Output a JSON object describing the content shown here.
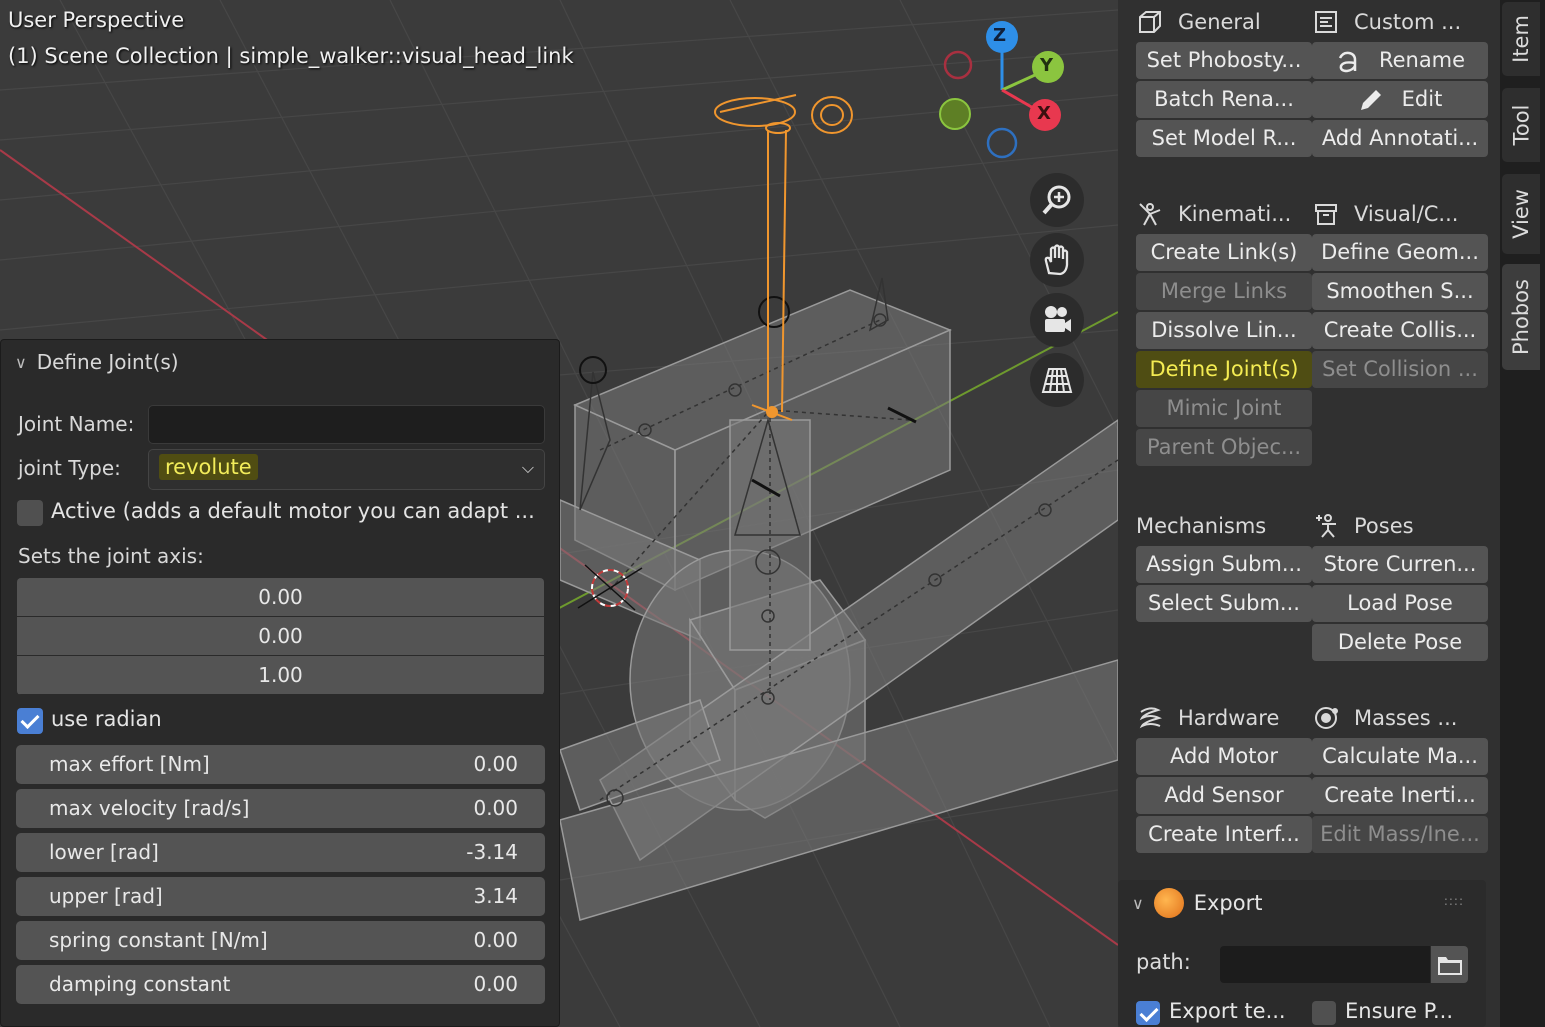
{
  "viewport": {
    "title": "User Perspective",
    "subtitle": "(1) Scene Collection | simple_walker::visual_head_link",
    "gizmo_axes": [
      "Z",
      "Y",
      "X"
    ],
    "nav_icons": [
      "zoom-icon",
      "hand-pan-icon",
      "camera-icon",
      "grid-perspective-icon"
    ]
  },
  "operator_panel": {
    "title": "Define Joint(s)",
    "joint_name_label": "Joint Name:",
    "joint_name_value": "",
    "joint_type_label": "joint Type:",
    "joint_type_value": "revolute",
    "active_label": "Active (adds a default motor you can adapt ...",
    "active_checked": false,
    "axis_label": "Sets the joint axis:",
    "axis": [
      "0.00",
      "0.00",
      "1.00"
    ],
    "use_radian_label": "use radian",
    "use_radian_checked": true,
    "fields": [
      {
        "label": "max effort [Nm]",
        "value": "0.00"
      },
      {
        "label": "max velocity [rad/s]",
        "value": "0.00"
      },
      {
        "label": "lower [rad]",
        "value": "-3.14"
      },
      {
        "label": "upper [rad]",
        "value": "3.14"
      },
      {
        "label": "spring constant [N/m]",
        "value": "0.00"
      },
      {
        "label": "damping constant",
        "value": "0.00"
      }
    ]
  },
  "phobos": {
    "general": {
      "title": "General",
      "buttons": [
        "Set Phobosty...",
        "Batch Rena...",
        "Set Model R..."
      ]
    },
    "custom": {
      "title": "Custom ...",
      "buttons": [
        "Rename",
        "Edit",
        "Add Annotati..."
      ]
    },
    "kinematics": {
      "title": "Kinemati...",
      "buttons": [
        "Create Link(s)",
        "Merge Links",
        "Dissolve Lin...",
        "Define Joint(s)",
        "Mimic Joint",
        "Parent Objec..."
      ]
    },
    "visual": {
      "title": "Visual/C...",
      "buttons": [
        "Define Geom...",
        "Smoothen S...",
        "Create Collis...",
        "Set Collision ..."
      ]
    },
    "mechanisms": {
      "title": "Mechanisms",
      "buttons": [
        "Assign Subm...",
        "Select Subm..."
      ]
    },
    "poses": {
      "title": "Poses",
      "buttons": [
        "Store Curren...",
        "Load Pose",
        "Delete Pose"
      ]
    },
    "hardware": {
      "title": "Hardware",
      "buttons": [
        "Add Motor",
        "Add Sensor",
        "Create Interf..."
      ]
    },
    "masses": {
      "title": "Masses ...",
      "buttons": [
        "Calculate Ma...",
        "Create Inerti...",
        "Edit Mass/Ine..."
      ]
    },
    "export": {
      "title": "Export",
      "path_label": "path:",
      "path_value": "",
      "export_textures_label": "Export te...",
      "export_textures_checked": true,
      "ensure_label": "Ensure P...",
      "ensure_checked": false
    }
  },
  "tabs": [
    "Item",
    "Tool",
    "View",
    "Phobos"
  ],
  "active_tab": "Phobos",
  "colors": {
    "highlight_bg": "#4f4d13",
    "highlight_text": "#f4ec52",
    "checkbox_blue": "#4a7fd4",
    "selection_orange": "#f0962e",
    "axis_x": "#e8384f",
    "axis_y": "#8bc53f",
    "axis_z": "#2e8fe8"
  }
}
